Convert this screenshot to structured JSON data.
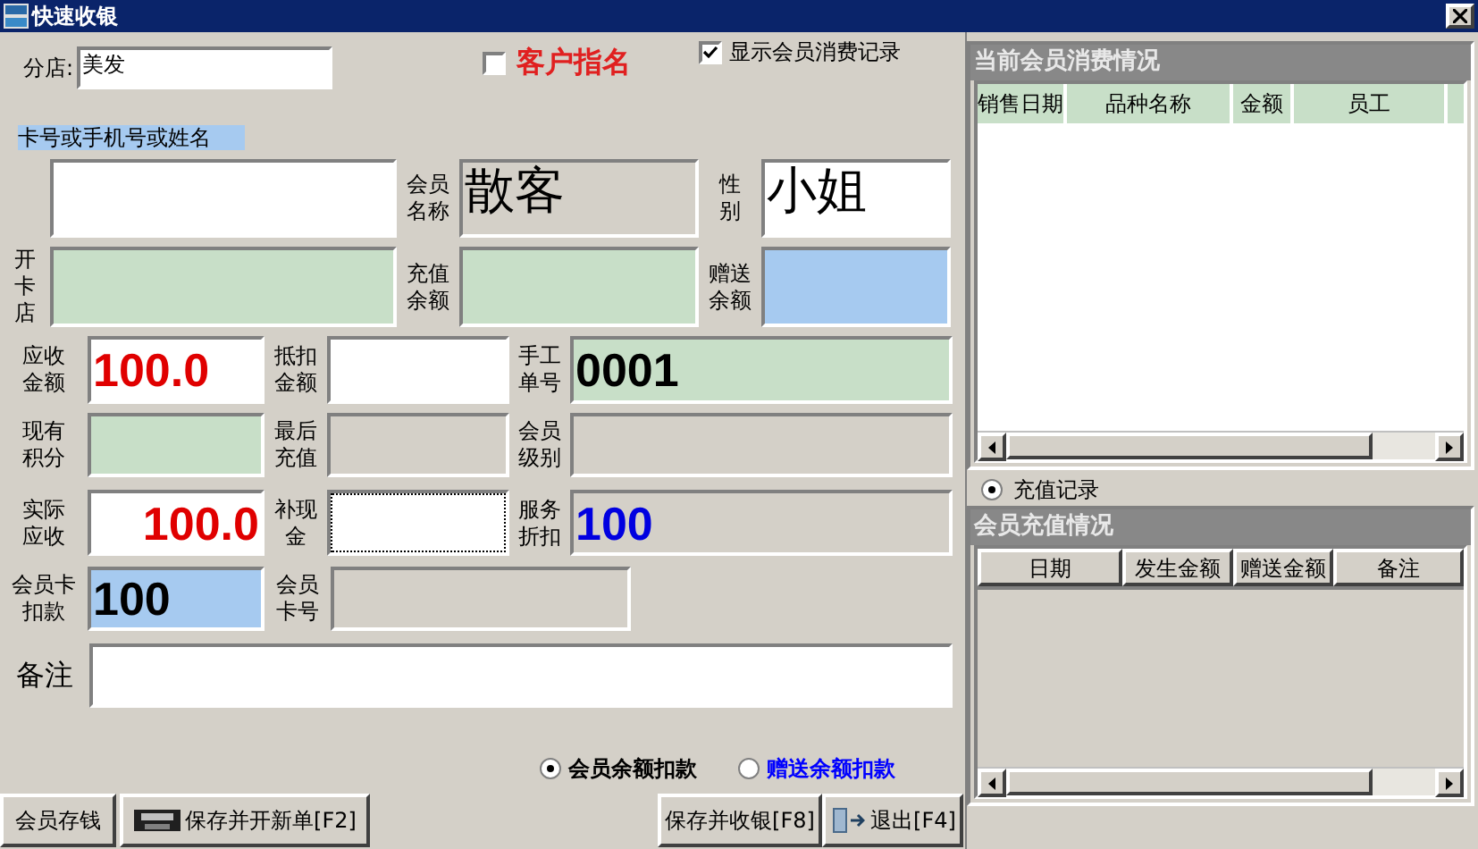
{
  "window": {
    "title": "快速收银"
  },
  "branch": {
    "label": "分店:",
    "value": "美发"
  },
  "options": [
    {
      "label": "客户指名",
      "checked": false,
      "kind": "emphasis"
    },
    {
      "label": "显示会员消费记录",
      "checked": true,
      "kind": "plain"
    }
  ],
  "search_label": "卡号或手机号或姓名",
  "rows": [
    [
      {
        "kind": "entry"
      },
      {
        "label_lines": [
          "会员",
          "名称"
        ],
        "value": "散客",
        "kind": "name"
      },
      {
        "label_lines": [
          "性",
          "别"
        ],
        "value": "小姐",
        "kind": "title"
      }
    ],
    [
      {
        "label_lines": [
          "开",
          "卡",
          "店"
        ],
        "kind": "info"
      },
      {
        "label_lines": [
          "充值",
          "余额"
        ],
        "kind": "info"
      },
      {
        "label_lines": [
          "赠送",
          "余额"
        ],
        "kind": "bonus"
      }
    ],
    [
      {
        "label_lines": [
          "应收",
          "金额"
        ],
        "value": "100.0",
        "kind": "amount"
      },
      {
        "label_lines": [
          "抵扣",
          "金额"
        ],
        "kind": "entry"
      },
      {
        "label_lines": [
          "手工",
          "单号"
        ],
        "value": "0001",
        "kind": "info"
      }
    ],
    [
      {
        "label_lines": [
          "现有",
          "积分"
        ],
        "kind": "info"
      },
      {
        "label_lines": [
          "最后",
          "充值"
        ],
        "kind": "readonly"
      },
      {
        "label_lines": [
          "会员",
          "级别"
        ],
        "kind": "readonly"
      }
    ],
    [
      {
        "label_lines": [
          "实际",
          "应收"
        ],
        "value": "100.0",
        "kind": "total"
      },
      {
        "label_lines": [
          "补现",
          "金"
        ],
        "kind": "entry",
        "focused": true
      },
      {
        "label_lines": [
          "服务",
          "折扣"
        ],
        "value": "100",
        "kind": "discount"
      }
    ],
    [
      {
        "label_lines": [
          "会员卡",
          "扣款"
        ],
        "value": "100",
        "kind": "bonus"
      },
      {
        "label_lines": [
          "会员",
          "卡号"
        ],
        "kind": "readonly"
      }
    ]
  ],
  "note": {
    "label": "备注"
  },
  "deduction_options": [
    {
      "label": "会员余额扣款",
      "selected": true,
      "color": "#000000"
    },
    {
      "label": "赠送余额扣款",
      "selected": false,
      "color": "#0000ff"
    }
  ],
  "left_buttons": [
    {
      "label": "会员存钱",
      "kind": "plain"
    },
    {
      "label": "保存并开新单[F2]",
      "kind": "save"
    }
  ],
  "right_buttons": [
    {
      "label": "保存并收银[F8]",
      "kind": "plain"
    },
    {
      "label": "退出[F4]",
      "kind": "exit"
    }
  ],
  "consumption_panel": {
    "title": "当前会员消费情况",
    "columns": [
      "销售日期",
      "品种名称",
      "金额",
      "员工"
    ]
  },
  "recharge_toggle": {
    "label": "充值记录",
    "selected": true
  },
  "recharge_panel": {
    "title": "会员充值情况",
    "columns": [
      "日期",
      "发生金额",
      "赠送金额",
      "备注"
    ]
  }
}
